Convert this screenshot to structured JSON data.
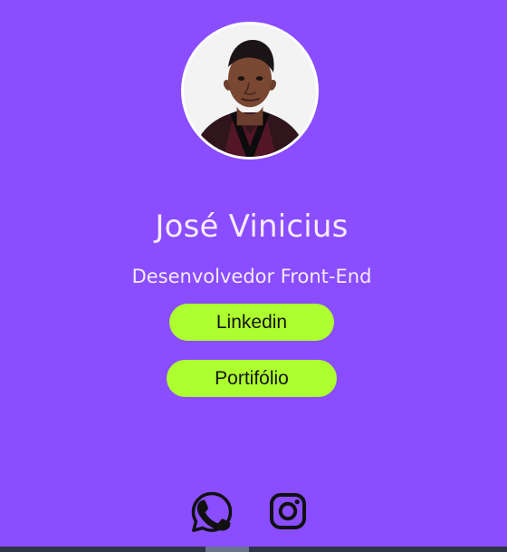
{
  "profile": {
    "name": "José Vinicius",
    "role": "Desenvolvedor Front-End",
    "photo_label": "José Vinicius"
  },
  "links": {
    "linkedin": "Linkedin",
    "portfolio": "Portifólio"
  },
  "socials": [
    {
      "icon": "whatsapp-icon"
    },
    {
      "icon": "instagram-icon"
    }
  ],
  "colors": {
    "background": "#8a4dff",
    "button": "#adff2f",
    "text": "#f8ecff",
    "icon": "#111111"
  }
}
